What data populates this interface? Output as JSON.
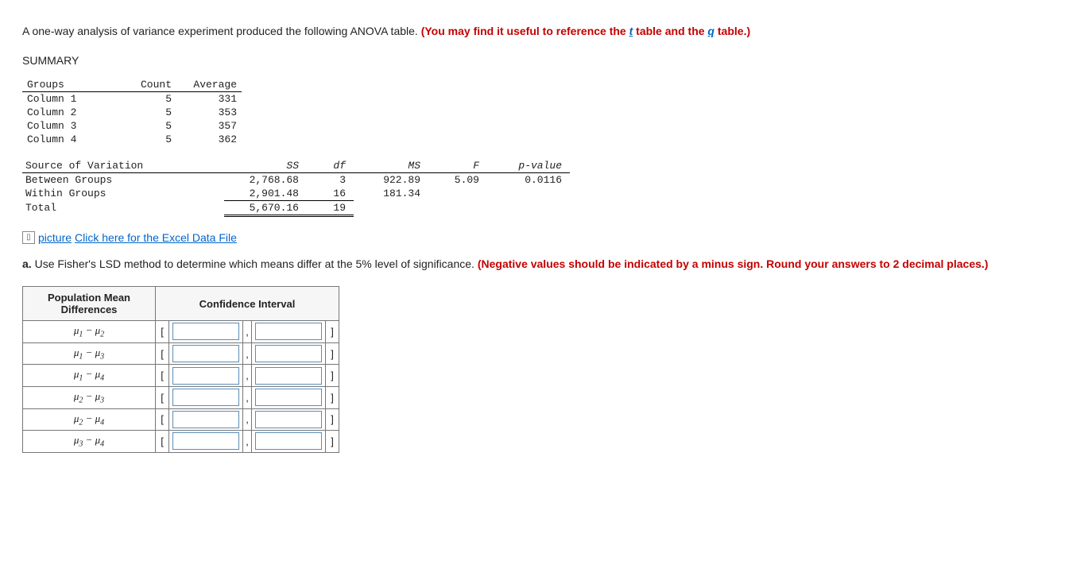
{
  "intro": {
    "plain1": "A one-way analysis of variance experiment produced the following ANOVA table. ",
    "red1": "(You may find it useful to reference the ",
    "link_t": "t",
    "red_table1": " table",
    "red_and": " and the ",
    "link_q": "q",
    "red_table2": " table",
    "red_close": ".)"
  },
  "summary_heading": "SUMMARY",
  "summary_table": {
    "headers": {
      "groups": "Groups",
      "count": "Count",
      "average": "Average"
    },
    "rows": [
      {
        "group": "Column 1",
        "count": "5",
        "avg": "331"
      },
      {
        "group": "Column 2",
        "count": "5",
        "avg": "353"
      },
      {
        "group": "Column 3",
        "count": "5",
        "avg": "357"
      },
      {
        "group": "Column 4",
        "count": "5",
        "avg": "362"
      }
    ]
  },
  "anova": {
    "headers": {
      "source": "Source of Variation",
      "ss": "SS",
      "df": "df",
      "ms": "MS",
      "f": "F",
      "p": "p-value"
    },
    "rows": {
      "between": {
        "label": "Between Groups",
        "ss": "2,768.68",
        "df": "3",
        "ms": "922.89",
        "f": "5.09",
        "p": "0.0116"
      },
      "within": {
        "label": "Within Groups",
        "ss": "2,901.48",
        "df": "16",
        "ms": "181.34",
        "f": "",
        "p": ""
      },
      "total": {
        "label": "Total",
        "ss": "5,670.16",
        "df": "19"
      }
    }
  },
  "file_link": {
    "alt": "picture",
    "text": "Click here for the Excel Data File"
  },
  "part_a": {
    "label": "a.",
    "plain": " Use Fisher's LSD method to determine which means differ at the 5% level of significance. ",
    "red": "(Negative values should be indicated by a minus sign. Round your answers to 2 decimal places.)"
  },
  "ci_table": {
    "col1": "Population Mean Differences",
    "col2": "Confidence Interval",
    "bracket_open": "[",
    "bracket_close": "]",
    "comma": ",",
    "rows": [
      "μ1 − μ2",
      "μ1 − μ3",
      "μ1 − μ4",
      "μ2 − μ3",
      "μ2 − μ4",
      "μ3 − μ4"
    ]
  }
}
